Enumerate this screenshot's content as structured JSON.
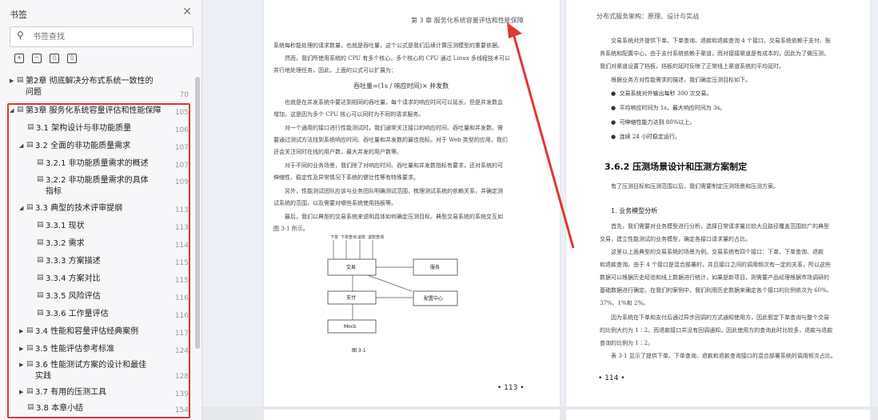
{
  "sidebar": {
    "title": "书签",
    "search_placeholder": "书签查找",
    "toc": [
      {
        "label": "第2章 彻底解决分布式系统一致性的问题",
        "page": "70"
      },
      {
        "label": "第3章 服务化系统容量评估和性能保障",
        "page": "105"
      },
      {
        "label": "3.1 架构设计与非功能质量",
        "page": "106"
      },
      {
        "label": "3.2 全面的非功能质量需求",
        "page": "107"
      },
      {
        "label": "3.2.1 非功能质量需求的概述",
        "page": "107"
      },
      {
        "label": "3.2.2 非功能质量需求的具体指标",
        "page": "109"
      },
      {
        "label": "3.3 典型的技术评审提纲",
        "page": "113"
      },
      {
        "label": "3.3.1 现状",
        "page": "113"
      },
      {
        "label": "3.3.2 需求",
        "page": "114"
      },
      {
        "label": "3.3.3 方案描述",
        "page": "115"
      },
      {
        "label": "3.3.4 方案对比",
        "page": "115"
      },
      {
        "label": "3.3.5 风险评估",
        "page": "116"
      },
      {
        "label": "3.3.6 工作量评估",
        "page": "116"
      },
      {
        "label": "3.4 性能和容量评估经典案例",
        "page": "117"
      },
      {
        "label": "3.5 性能评估参考标准",
        "page": "124"
      },
      {
        "label": "3.6 性能测试方案的设计和最佳实践",
        "page": "128"
      },
      {
        "label": "3.7 有用的压测工具",
        "page": "139"
      },
      {
        "label": "3.8 本章小结",
        "page": "154"
      }
    ]
  },
  "page113": {
    "header": "第 3 章   服务化系统容量评估和性能保障",
    "lines": [
      "系统每秒能处理的请求数量，也就是吞吐量，这个公式是我们后续计算压测模型的重要依据。",
      "然而，我们所使用系统的 CPU 有多个核心，多个核心的 CPU 通过 Linux 多线程技术可以",
      "并行地处理任务，因此，上面的公式可以扩展为：",
      "也就是在并发系统中要达到相同的吞吐量，每个请求的响应时间可以延长，但是并发数会",
      "增加，这是因为多个 CPU 核心可以同时为不同的请求服务。",
      "对一个通用的接口进行性能测试时，我们通常关注接口的响应时间、吞吐量和并发数。需",
      "要通过测试方法找到系统响应时间、吞吐量和并发数的最佳指标。对于 Web 类型的应用，我们",
      "还会关注同时在线的用户数，最大并发的用户数等。",
      "对于不同的业务场景，我们除了对响应时间、吞吐量和并发数指标有要求，还对系统的可",
      "伸缩性、稳定性及异常情况下系统的健壮性等有特殊要求。",
      "另外，性能测试团队应该与业务团队明确测试范围，梳理测试系统的依赖关系，并确定测",
      "试系统的范围，以及需要对哪些系统使用挡板等。",
      "最后，我们以典型的交易系统来说明具体如何确定压测目标。典型交易系统的系统交互如",
      "图 3-1 所示。"
    ],
    "formula": "吞吐量=(1s / 响应时间)× 并发数",
    "diagram": {
      "top_labels": [
        "下单",
        "下单查询",
        "退款",
        "退款查询"
      ],
      "boxes": [
        "交易",
        "服务",
        "支付",
        "配置中心",
        "Mock"
      ],
      "caption": "图 3-1"
    },
    "page_number": "• 113 •"
  },
  "page114": {
    "header": "分布式服务架构：原理、设计与实战",
    "lines": [
      "交易系统对外提供下单、下单查询、退款和退款查询 4 个接口，交易系统依赖于支付、账",
      "务系统和配置中心，由于支付系统依赖于渠道，而对接接渠道是有成本的，因此为了做压测，",
      "我们对渠道设置了挡板，挡板的延时反映了正常线上渠道系统的平均延时。",
      "根据业务方对性能需求的描述，我们确定压测目标如下。"
    ],
    "bullets": [
      "交易系统对外输出每秒 300 次交易。",
      "平均响应时间为 1s，最大响应时间为 3s。",
      "可伸缩性能力达到 80%以上。",
      "连续 24 小时稳定运行。"
    ],
    "section_title": "3.6.2  压测场景设计和压测方案制定",
    "section_intro": "有了压测目标和压测范围以后，我们需要制定压测场景和压测方案。",
    "sub_title": "1. 业务模型分析",
    "para": [
      "首先，我们需要对业务模型进行分析，选择日常请求量比较大且路径覆盖范围较广的典型",
      "交易，建立性能测试的业务模型，确定各接口请求量的占比。",
      "这里以上面典型的交易系统的场景为例。交易系统有四个接口：下单、下单查询、退款",
      "和退款查询。由于 4 个接口是混合部署的，并且接口之间的调用频次有一定的关系，所以这些",
      "数据可以根据历史经验和线上数据进行统计，如果是新项目，则需要产品经理根据市场调研的",
      "基础数据进行确定。在我们的案例中，我们利用历史数据来确定各个接口的比例依次为 60%、",
      "37%、1%和 2%。",
      "因为系统在下单和支付后通过异步回调的方式通知使用方，因此假定下单查询与整个交易",
      "的比例大约为 1∶2。而退款接口并没有回调通知，因此使用方的查询此时比较多，退款与退款",
      "查询的比例为 1∶2。",
      "表 3-1 显示了提供下单、下单查询、退款和退款查询接口的混合部署系统的调用频次占比。"
    ],
    "page_number": "• 114 •"
  },
  "colors": {
    "highlight_box": "#e23636",
    "arrow": "#e23636"
  }
}
